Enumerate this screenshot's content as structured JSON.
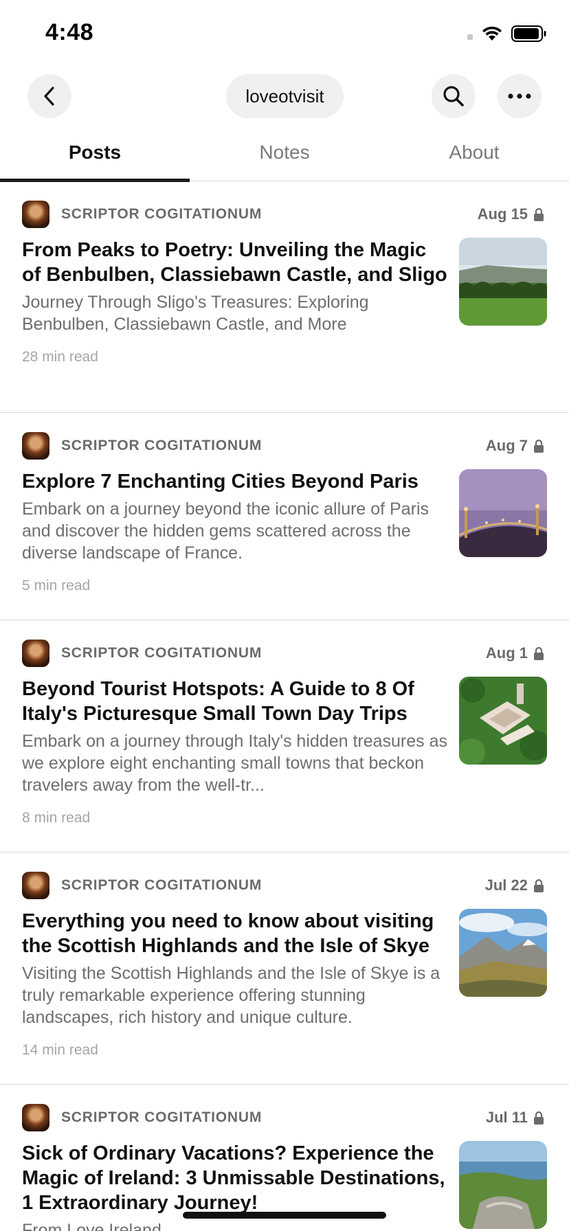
{
  "status": {
    "time": "4:48"
  },
  "nav": {
    "back_icon": "chevron-left-icon",
    "title": "loveotvisit",
    "search_icon": "search-icon",
    "more_icon": "more-horizontal-icon"
  },
  "tabs": [
    {
      "label": "Posts",
      "active": true
    },
    {
      "label": "Notes",
      "active": false
    },
    {
      "label": "About",
      "active": false
    }
  ],
  "posts": [
    {
      "author": "SCRIPTOR COGITATIONUM",
      "date": "Aug 15",
      "title": "From Peaks to Poetry: Unveiling the Magic of Benbulben, Classiebawn Castle, and Sligo",
      "subtitle": "Journey Through Sligo's Treasures: Exploring Benbulben, Classiebawn Castle, and More",
      "read_time": "28 min read"
    },
    {
      "author": "SCRIPTOR COGITATIONUM",
      "date": "Aug 7",
      "title": "Explore 7 Enchanting Cities Beyond Paris",
      "subtitle": "Embark on a journey beyond the iconic allure of Paris and discover the hidden gems scattered across the diverse landscape of France.",
      "read_time": "5 min read"
    },
    {
      "author": "SCRIPTOR COGITATIONUM",
      "date": "Aug 1",
      "title": "Beyond Tourist Hotspots: A Guide to 8 Of Italy's Picturesque Small Town Day Trips",
      "subtitle": "Embark on a journey through Italy's hidden treasures as we explore eight enchanting small towns that beckon travelers away from the well-tr...",
      "read_time": "8 min read"
    },
    {
      "author": "SCRIPTOR COGITATIONUM",
      "date": "Jul 22",
      "title": "Everything you need to know about visiting the Scottish Highlands and the Isle of Skye",
      "subtitle": "Visiting the Scottish Highlands and the Isle of Skye is a truly remarkable experience offering stunning landscapes, rich history and unique culture.",
      "read_time": "14 min read"
    },
    {
      "author": "SCRIPTOR COGITATIONUM",
      "date": "Jul 11",
      "title": "Sick of Ordinary Vacations? Experience the Magic of Ireland: 3 Unmissable Destinations, 1 Extraordinary Journey!",
      "subtitle": "From Love Ireland",
      "read_time": ""
    }
  ]
}
